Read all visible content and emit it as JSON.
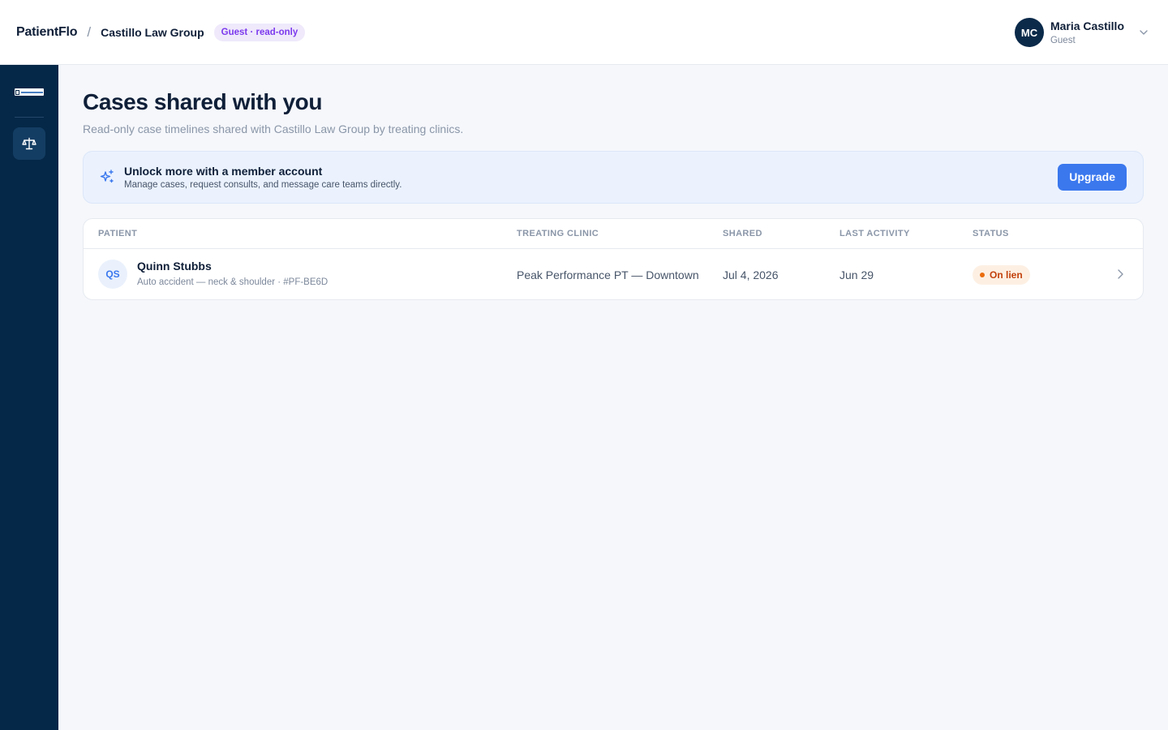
{
  "header": {
    "brand": "PatientFlo",
    "separator": "/",
    "org_name": "Castillo Law Group",
    "guest_badge": "Guest · read-only"
  },
  "user": {
    "initials": "MC",
    "name": "Maria Castillo",
    "role": "Guest",
    "menu_icon": "chevron-down-icon"
  },
  "sidebar": {
    "logo": "patientflo-logo",
    "items": [
      {
        "icon": "scale-icon",
        "active": true
      }
    ]
  },
  "page": {
    "title": "Cases shared with you",
    "subtitle": "Read-only case timelines shared with Castillo Law Group by treating clinics."
  },
  "upsell": {
    "icon": "sparkle-icon",
    "title": "Unlock more with a member account",
    "description": "Manage cases, request consults, and message care teams directly.",
    "button_label": "Upgrade"
  },
  "table": {
    "columns": [
      "PATIENT",
      "TREATING CLINIC",
      "SHARED",
      "LAST ACTIVITY",
      "STATUS"
    ],
    "rows": [
      {
        "initials": "QS",
        "patient": "Quinn Stubbs",
        "description": "Auto accident — neck & shoulder · #PF-BE6D",
        "clinic": "Peak Performance PT — Downtown",
        "shared": "Jul 4, 2026",
        "last_activity": "Jun 29",
        "status": "On lien"
      }
    ]
  },
  "colors": {
    "sidebar": "#052848",
    "accent": "#3b78ee",
    "guest_badge_text": "#7c3aed",
    "status_lien": "#c2410c"
  }
}
